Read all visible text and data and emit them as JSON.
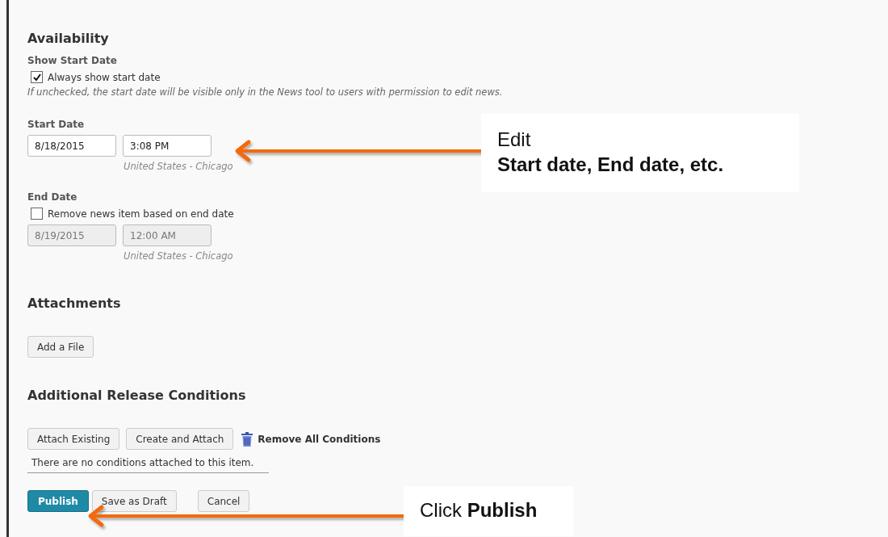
{
  "availability": {
    "heading": "Availability",
    "show_start_date": {
      "label": "Show Start Date",
      "checkbox": {
        "label": "Always show start date",
        "checked": true
      },
      "hint": "If unchecked, the start date will be visible only in the News tool to users with permission to edit news."
    },
    "start_date": {
      "label": "Start Date",
      "date": "8/18/2015",
      "time": "3:08 PM",
      "disabled": false,
      "timezone": "United States - Chicago"
    },
    "end_date": {
      "label": "End Date",
      "checkbox": {
        "label": "Remove news item based on end date",
        "checked": false
      },
      "date": "8/19/2015",
      "time": "12:00 AM",
      "disabled": true,
      "timezone": "United States - Chicago"
    }
  },
  "attachments": {
    "heading": "Attachments",
    "buttons": [
      "Add a File"
    ]
  },
  "release_conditions": {
    "heading": "Additional Release Conditions",
    "buttons": [
      "Attach Existing",
      "Create and Attach"
    ],
    "remove_link": "Remove All Conditions",
    "empty_message": "There are no conditions attached to this item."
  },
  "actions": [
    {
      "label": "Publish",
      "primary": true
    },
    {
      "label": "Save as Draft",
      "primary": false
    },
    {
      "label": "Cancel",
      "primary": false
    }
  ],
  "callouts": [
    {
      "lines": [
        {
          "text": "Edit",
          "bold": false
        },
        {
          "text": "Start date, End date, etc.",
          "bold": true
        }
      ]
    },
    {
      "lines": [
        {
          "text": "Click **Publish**",
          "bold": false
        }
      ]
    }
  ]
}
